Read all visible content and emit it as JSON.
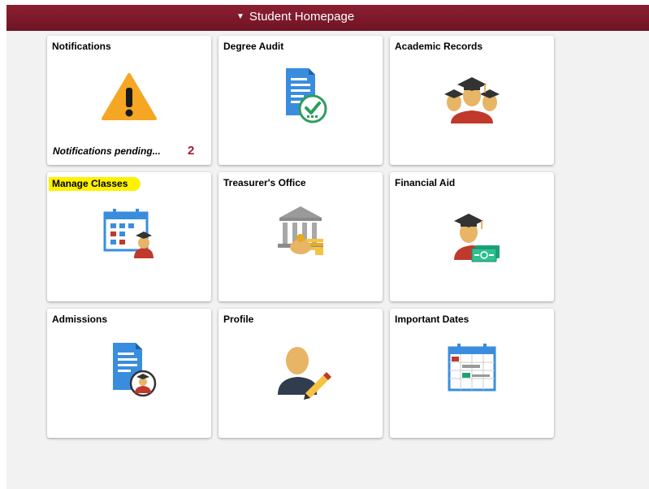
{
  "header": {
    "title": "Student Homepage",
    "bar_color": "#7a1a2c"
  },
  "tiles": [
    {
      "title": "Notifications",
      "icon": "warning-icon",
      "footer": "Notifications pending...",
      "count": "2"
    },
    {
      "title": "Degree Audit",
      "icon": "degree-audit-icon"
    },
    {
      "title": "Academic Records",
      "icon": "academic-records-icon"
    },
    {
      "title": "Manage Classes",
      "icon": "manage-classes-icon",
      "highlighted": true
    },
    {
      "title": "Treasurer's Office",
      "icon": "treasurers-office-icon"
    },
    {
      "title": "Financial Aid",
      "icon": "financial-aid-icon"
    },
    {
      "title": "Admissions",
      "icon": "admissions-icon"
    },
    {
      "title": "Profile",
      "icon": "profile-icon"
    },
    {
      "title": "Important Dates",
      "icon": "important-dates-icon"
    }
  ],
  "colors": {
    "warning": "#f5a623",
    "doc_blue": "#3a8dde",
    "success_green": "#2e9e5b",
    "skin": "#e8b465",
    "gown_red": "#c0392b",
    "count_red": "#a51c30"
  }
}
